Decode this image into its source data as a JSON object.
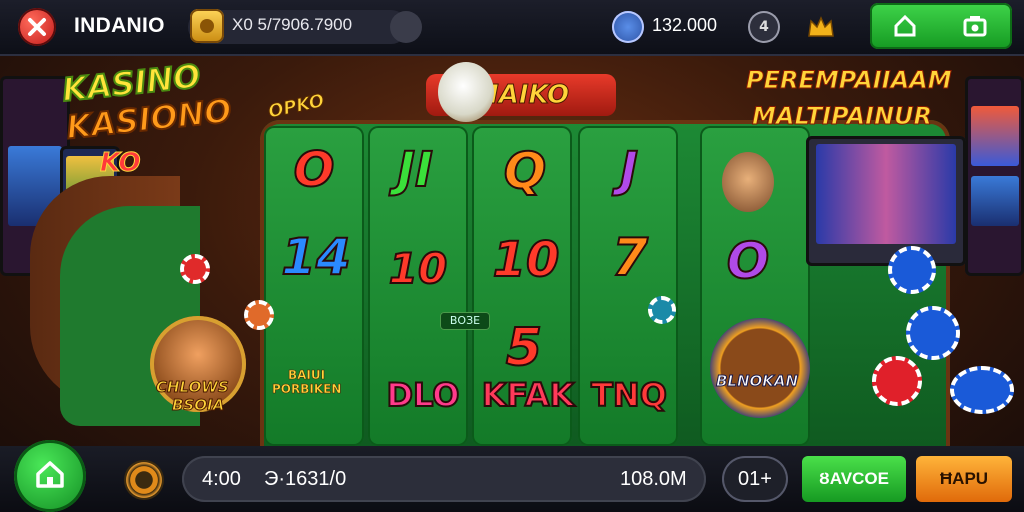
{
  "topbar": {
    "brand": "INDANIO",
    "coins_text": "X0 5/7906.7900",
    "balance": "132.000",
    "user_badge": "4"
  },
  "scene": {
    "left_logo_line1": "KASINO",
    "left_logo_line2": "KASIONO",
    "left_badge": "KO",
    "center_banner": "MAIKO",
    "board_badge": "OPKO",
    "right_banner_line1": "PEREMPAIIAAM",
    "right_banner_line2": "MALTIPAINUR",
    "reels": {
      "col1": [
        "O",
        "14"
      ],
      "col2": [
        "JI",
        "10"
      ],
      "col3": [
        "Q",
        "10",
        "5"
      ],
      "col4": [
        "J",
        "7"
      ],
      "col5": [
        "O"
      ]
    },
    "reel_tag": "ВОЗЕ",
    "win_labels": [
      "DLO",
      "KFAK",
      "TNQ"
    ],
    "char_label_left_1": "CHLOWS",
    "char_label_left_2": "BSOIA",
    "mid_label_1": "BAIUI",
    "mid_label_2": "PORBIKEN",
    "chest_label": "BLNOKAN"
  },
  "bottombar": {
    "time": "4:00",
    "credit": "Э·1631/0",
    "total": "108.0M",
    "bet": "01+",
    "green_button": "ȢAVCOE",
    "orange_button": "ĦAPU"
  },
  "colors": {
    "felt": "#1d8a35",
    "accent_green": "#2ebd3c",
    "accent_orange": "#f08a1a",
    "brand_red": "#d42020"
  }
}
